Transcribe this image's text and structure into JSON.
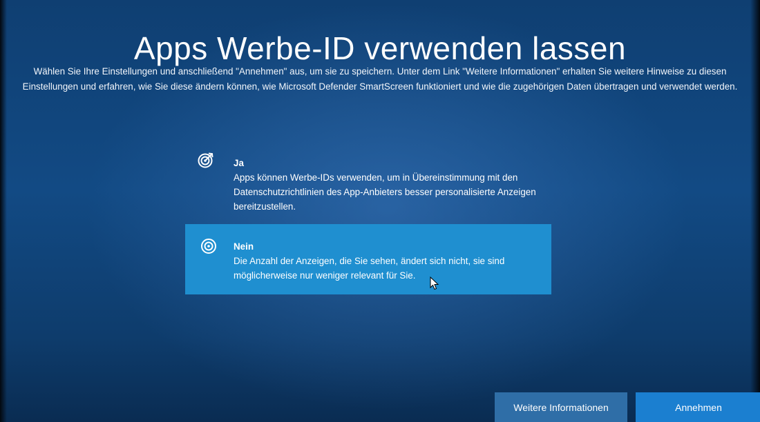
{
  "page": {
    "title": "Apps Werbe-ID verwenden lassen",
    "description": "Wählen Sie Ihre Einstellungen und anschließend \"Annehmen\" aus, um sie zu speichern. Unter dem Link \"Weitere Informationen\" erhalten Sie weitere Hinweise zu diesen Einstellungen und erfahren, wie Sie diese ändern können, wie Microsoft Defender SmartScreen funktioniert und wie die zugehörigen Daten übertragen und verwendet werden."
  },
  "options": [
    {
      "heading": "Ja",
      "text": "Apps können Werbe-IDs verwenden, um in Übereinstimmung mit den Datenschutzrichtlinien des App-Anbieters besser personalisierte Anzeigen bereitzustellen.",
      "icon": "target-icon",
      "selected": false
    },
    {
      "heading": "Nein",
      "text": "Die Anzahl der Anzeigen, die Sie sehen, ändert sich nicht, sie sind möglicherweise nur weniger relevant für Sie.",
      "icon": "target-off-icon",
      "selected": true
    }
  ],
  "buttons": {
    "more_info": "Weitere Informationen",
    "accept": "Annehmen"
  },
  "colors": {
    "background": "#124a84",
    "selected_option": "#1f8fd0",
    "info_button": "#2f6ea7",
    "accept_button": "#1b7fd0"
  }
}
